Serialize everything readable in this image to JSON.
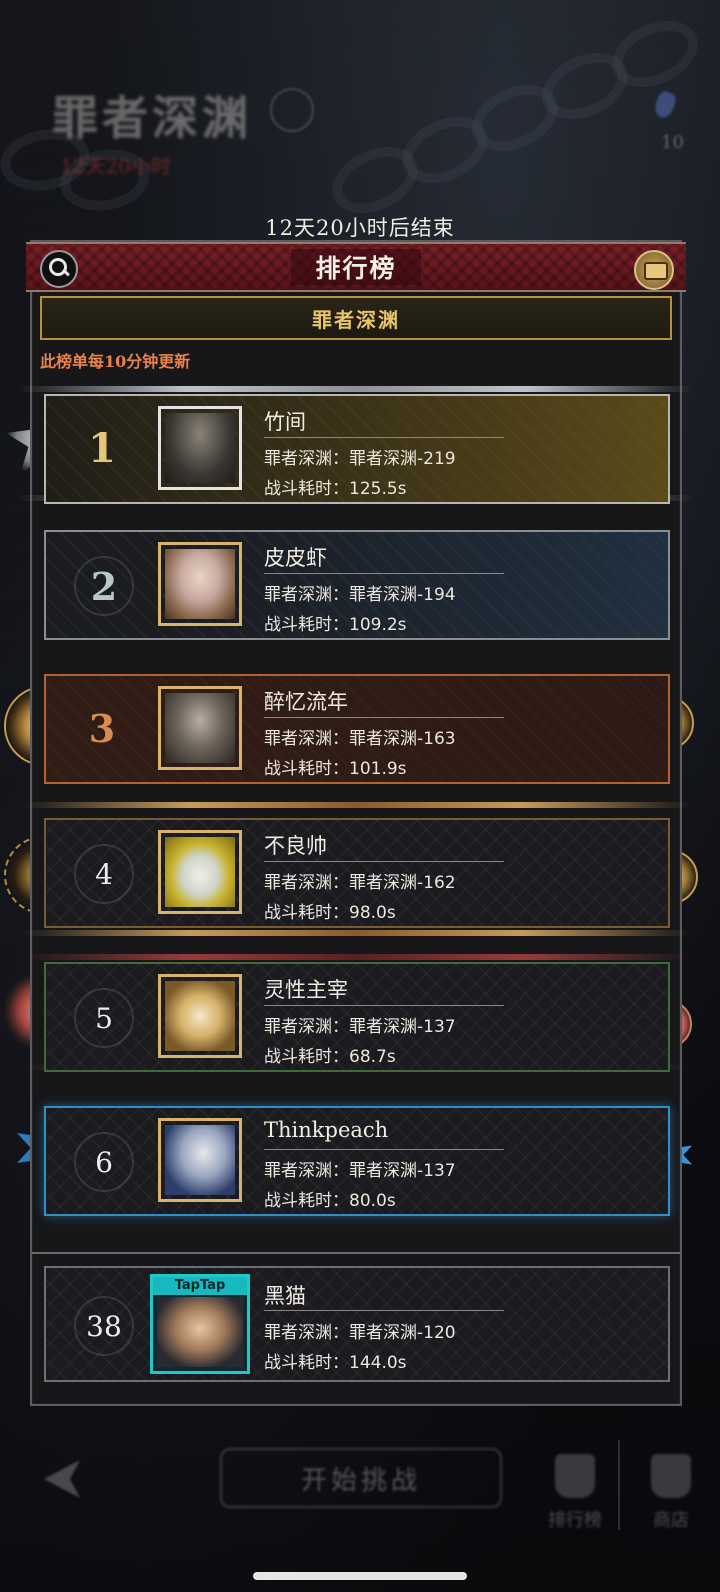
{
  "background": {
    "event_title": "罪者深渊",
    "event_timer": "12天20小时",
    "gem_count": "10"
  },
  "countdown": "12天20小时后结束",
  "panel": {
    "title": "排行榜",
    "tab_label": "罪者深渊",
    "notice": "此榜单每10分钟更新"
  },
  "rows": [
    {
      "rank": "1",
      "name": "竹间",
      "line1": "罪者深渊：罪者深渊-219",
      "line2": "战斗耗时：125.5s"
    },
    {
      "rank": "2",
      "name": "皮皮虾",
      "line1": "罪者深渊：罪者深渊-194",
      "line2": "战斗耗时：109.2s"
    },
    {
      "rank": "3",
      "name": "醉忆流年",
      "line1": "罪者深渊：罪者深渊-163",
      "line2": "战斗耗时：101.9s"
    },
    {
      "rank": "4",
      "name": "不良帅",
      "line1": "罪者深渊：罪者深渊-162",
      "line2": "战斗耗时：98.0s"
    },
    {
      "rank": "5",
      "name": "灵性主宰",
      "line1": "罪者深渊：罪者深渊-137",
      "line2": "战斗耗时：68.7s"
    },
    {
      "rank": "6",
      "name": "Thinkpeach",
      "line1": "罪者深渊：罪者深渊-137",
      "line2": "战斗耗时：80.0s"
    }
  ],
  "my_row": {
    "rank": "38",
    "name": "黑猫",
    "line1": "罪者深渊：罪者深渊-120",
    "line2": "战斗耗时：144.0s",
    "avatar_badge": "TapTap"
  },
  "bottom": {
    "start_button": "开始挑战",
    "nav_rank": "排行榜",
    "nav_shop": "商店"
  },
  "colors": {
    "header_red": "#7a2028",
    "tab_gold": "#e8c56a",
    "notice_orange": "#e8824a",
    "rank1_gold": "#e6c57a",
    "rank3_bronze": "#d98a4f",
    "rank6_blue": "#2f8fc9"
  }
}
